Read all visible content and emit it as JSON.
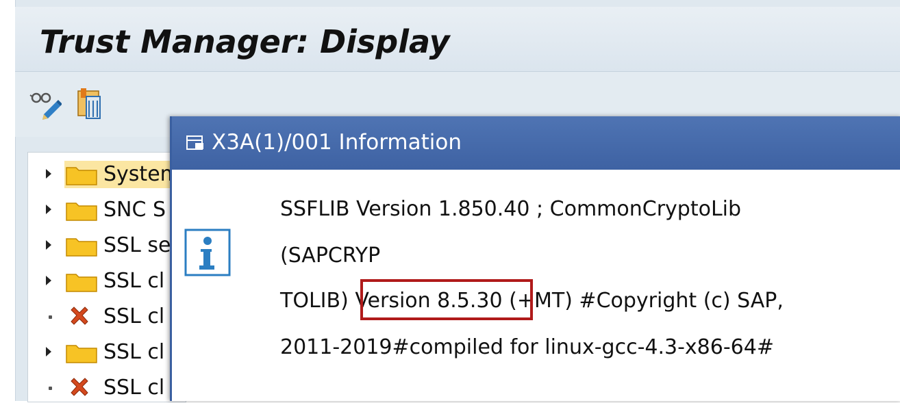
{
  "window": {
    "title": "Trust Manager: Display"
  },
  "toolbar": {
    "buttons": [
      {
        "icon": "display-change-icon"
      },
      {
        "icon": "environment-key-icon"
      }
    ]
  },
  "tree": {
    "items": [
      {
        "label": "System",
        "icon": "folder-icon",
        "expandable": true,
        "selected": true
      },
      {
        "label": "SNC S",
        "icon": "folder-icon",
        "expandable": true,
        "selected": false
      },
      {
        "label": "SSL se",
        "icon": "folder-icon",
        "expandable": true,
        "selected": false
      },
      {
        "label": "SSL cl",
        "icon": "folder-icon",
        "expandable": true,
        "selected": false
      },
      {
        "label": "SSL cl",
        "icon": "error-x-icon",
        "expandable": false,
        "selected": false
      },
      {
        "label": "SSL cl",
        "icon": "folder-icon",
        "expandable": true,
        "selected": false
      },
      {
        "label": "SSL cl",
        "icon": "error-x-icon",
        "expandable": false,
        "selected": false
      }
    ]
  },
  "dialog": {
    "title": "X3A(1)/001 Information",
    "message": {
      "line1": "SSFLIB Version 1.850.40 ; CommonCryptoLib",
      "line2": "(SAPCRYP",
      "line3_prefix": "TOLIB) ",
      "line3_highlight": "Version 8.5.30",
      "line3_suffix": " (+MT) #Copyright (c) SAP,",
      "line4": "2011-2019#compiled for linux-gcc-4.3-x86-64#"
    },
    "highlight_color": "#b01a1a"
  },
  "colors": {
    "dialog_title_bg": "#4270b0",
    "frame_bg": "#dfe8ef",
    "selection_bg": "#fbe6a2",
    "folder": "#f7c325"
  }
}
